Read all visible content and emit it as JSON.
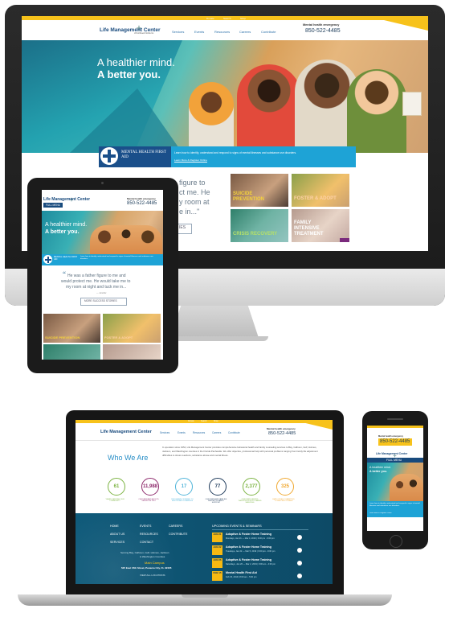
{
  "site": {
    "logo_name": "Life Management Center",
    "logo_sub": "of Northwest Florida Inc.",
    "top_links": [
      "Donate",
      "Search",
      "Shop"
    ],
    "nav": [
      "Services",
      "Events",
      "Resources",
      "Careers",
      "Contribute"
    ],
    "emergency_label": "Mental health emergency",
    "emergency_phone": "850-522-4485"
  },
  "hero": {
    "line1": "A healthier mind.",
    "line2": "A better you."
  },
  "mhfa": {
    "badge": "MENTAL HEALTH FIRST AID",
    "text": "Learn how to identify, understand and respond to signs of mental illnesses and substance use disorders.",
    "link": "Learn More & Register Online"
  },
  "testimonial": {
    "quote_line1": "He was a father figure to me and",
    "quote_line2": "would protect me. He would take me to",
    "quote_line3": "my room at night and tuck me in...",
    "author": "— Jennifer",
    "button": "MORE SUCCESS STORIES",
    "desktop_fragment1": "figure to",
    "desktop_fragment2": "ct me. He",
    "desktop_fragment3": "y room at",
    "desktop_fragment4": "e in...\"",
    "desktop_btn_fragment": "IES"
  },
  "tiles": [
    {
      "label": "SUICIDE PREVENTION"
    },
    {
      "label": "FOSTER & ADOPT"
    },
    {
      "label": "CRISIS RECOVERY"
    },
    {
      "label": "FAMILY INTENSIVE TREATMENT"
    }
  ],
  "tablet": {
    "menu_label": "FULL MENU"
  },
  "who": {
    "title": "Who We Are",
    "body": "In operation since 1954, Life Management Center provides comprehensive behavioral health and family counseling services to Bay, Calhoun, Gulf, Holmes, Jackson, and Washington counties in the Florida Panhandle. We offer objective, professional help with personal problems ranging from family life adjustment difficulties to stress reactions, substance abuse and mental illness."
  },
  "stats": [
    {
      "value": "61",
      "label": "YEARS SERVING OUR COMMUNITY",
      "color": "#7cb342"
    },
    {
      "value": "11,988",
      "label": "CHILDREN AND ADULTS SERVED IN 2014",
      "color": "#8e2a6c"
    },
    {
      "value": "17",
      "label": "PROGRAMS OFFERED TO INDIVIDUALS & FAMILIES",
      "color": "#4fb4d9"
    },
    {
      "value": "77",
      "label": "CHILDREN AND FAMILIES SERVED IN FAMILY SUPPORT",
      "color": "#1e3a5a"
    },
    {
      "value": "2,377",
      "label": "CHILDREN SERVED THROUGH SCHOOL-BASED SERVICES",
      "color": "#7cb342"
    },
    {
      "value": "325",
      "label": "EMPLOYEES COMMITTED TO HELPING OTHERS",
      "color": "#f0a830"
    }
  ],
  "footer": {
    "menu": [
      "HOME",
      "EVENTS",
      "CAREERS",
      "ABOUT US",
      "RESOURCES",
      "CONTRIBUTE",
      "SERVICES",
      "CONTACT"
    ],
    "serving_line1": "Serving Bay, Calhoun, Gulf, Holmes, Jackson",
    "serving_line2": "& Washington Counties",
    "campus_title": "Main Campus",
    "campus_address": "525 East 15th Street, Panama City, FL 32405",
    "view_all": "VIEW ALL LOCATIONS",
    "events_title": "UPCOMING EVENTS & SEMINARS",
    "events": [
      {
        "date": "JAN 21",
        "title": "Adoptive & Foster Home Training",
        "sub": "Mondays, Jan 21 — Mar 4, 2019 | 6:00 pm - 9:00 pm"
      },
      {
        "date": "JAN 22",
        "title": "Adoptive & Foster Home Training",
        "sub": "Tuesdays, Jan 22 — Mar 5, 2019 | 6:00 pm - 9:00 pm"
      },
      {
        "date": "JAN 26",
        "title": "Adoptive & Foster Home Training",
        "sub": "Saturdays, Jan 26 — Mar 2, 2019 | 9:00 am - 4:00 pm"
      },
      {
        "date": "FEB 15",
        "title": "Mental Health First Aid",
        "sub": "Feb 15, 2019 | 8:00 am - 5:00 pm"
      }
    ]
  },
  "phone_view": {
    "hero_line1": "A healthier mind.",
    "hero_line2": "A better you.",
    "menu_label": "FULL MENU"
  },
  "colors": {
    "accent_yellow": "#f7c21b",
    "brand_blue": "#184a7d",
    "footer_teal": "#0e4f6c",
    "mhfa_blue": "#1ea3d6"
  }
}
